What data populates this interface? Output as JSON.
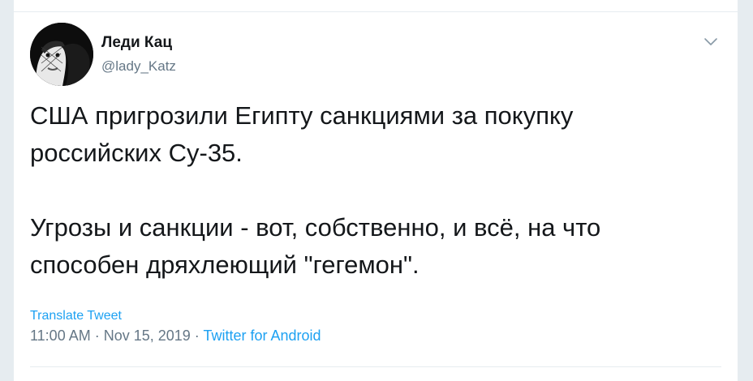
{
  "tweet": {
    "author_name": "Леди Кац",
    "author_handle": "@lady_Katz",
    "text": "США пригрозили Египту санкциями за покупку\nроссийских Су-35.\n\nУгрозы и санкции - вот, собственно, и всё, на что\nспособен дряхлеющий \"гегемон\".",
    "translate_label": "Translate Tweet",
    "time": "11:00 AM",
    "date": "Nov 15, 2019",
    "separator": " · ",
    "source": "Twitter for Android"
  },
  "icons": {
    "menu": "chevron-down-icon",
    "avatar": "avatar"
  },
  "colors": {
    "text": "#14171a",
    "secondary": "#657786",
    "link": "#1da1f2",
    "border": "#e6ecf0",
    "background": "#ffffff"
  }
}
